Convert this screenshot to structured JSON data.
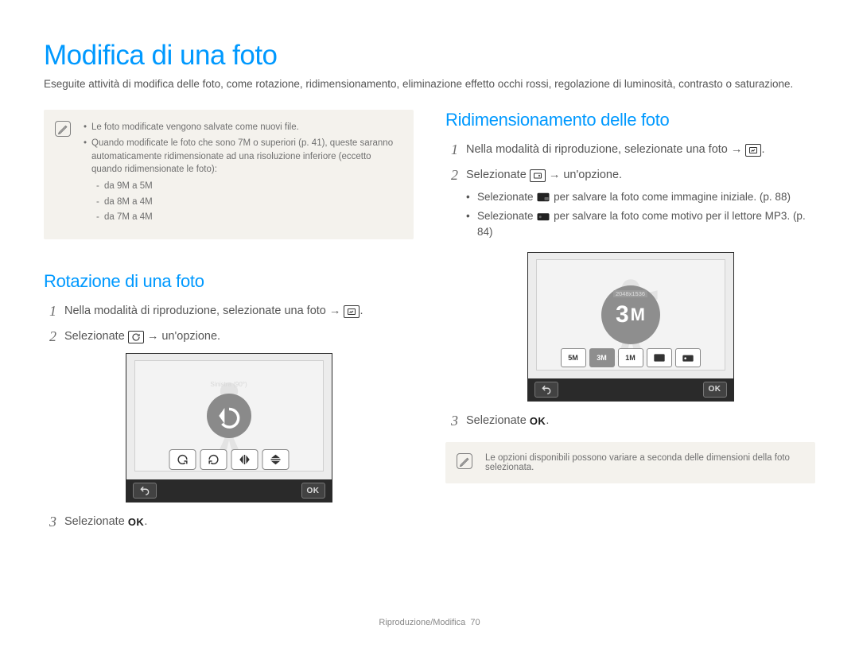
{
  "page": {
    "title": "Modifica di una foto",
    "intro": "Eseguite attività di modifica delle foto, come rotazione, ridimensionamento, eliminazione effetto occhi rossi, regolazione di luminosità, contrasto o saturazione."
  },
  "topnote": {
    "items": [
      "Le foto modificate vengono salvate come nuovi file.",
      "Quando modificate le foto che sono 7M o superiori (p. 41), queste saranno automaticamente ridimensionate ad una risoluzione inferiore (eccetto quando ridimensionate le foto):"
    ],
    "sub": [
      "da 9M a 5M",
      "da 8M a 4M",
      "da 7M a 4M"
    ]
  },
  "rotate": {
    "heading": "Rotazione di una foto",
    "step1": "Nella modalità di riproduzione, selezionate una foto → ",
    "step2_pre": "Selezionate ",
    "step2_post": " → un'opzione.",
    "step3": "Selezionate ",
    "tooltip": "Sinistra (90°)"
  },
  "resize": {
    "heading": "Ridimensionamento delle foto",
    "step1": "Nella modalità di riproduzione, selezionate una foto → ",
    "step2_pre": "Selezionate ",
    "step2_post": " → un'opzione.",
    "step2_sub1": "Selezionate  per salvare la foto come immagine iniziale. (p. 88)",
    "step2_sub2": "Selezionate  per salvare la foto come motivo per il lettore MP3. (p. 84)",
    "step3": "Selezionate ",
    "center_dim": "2048x1536",
    "center_val": "3",
    "options": [
      "5M",
      "3M",
      "1M"
    ],
    "bottomnote": "Le opzioni disponibili possono variare a seconda delle dimensioni della foto selezionata."
  },
  "footer": {
    "chapter": "Riproduzione/Modifica",
    "page": "70"
  },
  "icons": {
    "edit": "edit-icon",
    "rotate": "rotate-icon",
    "resize": "resize-icon",
    "back": "back-icon",
    "ok": "OK"
  }
}
